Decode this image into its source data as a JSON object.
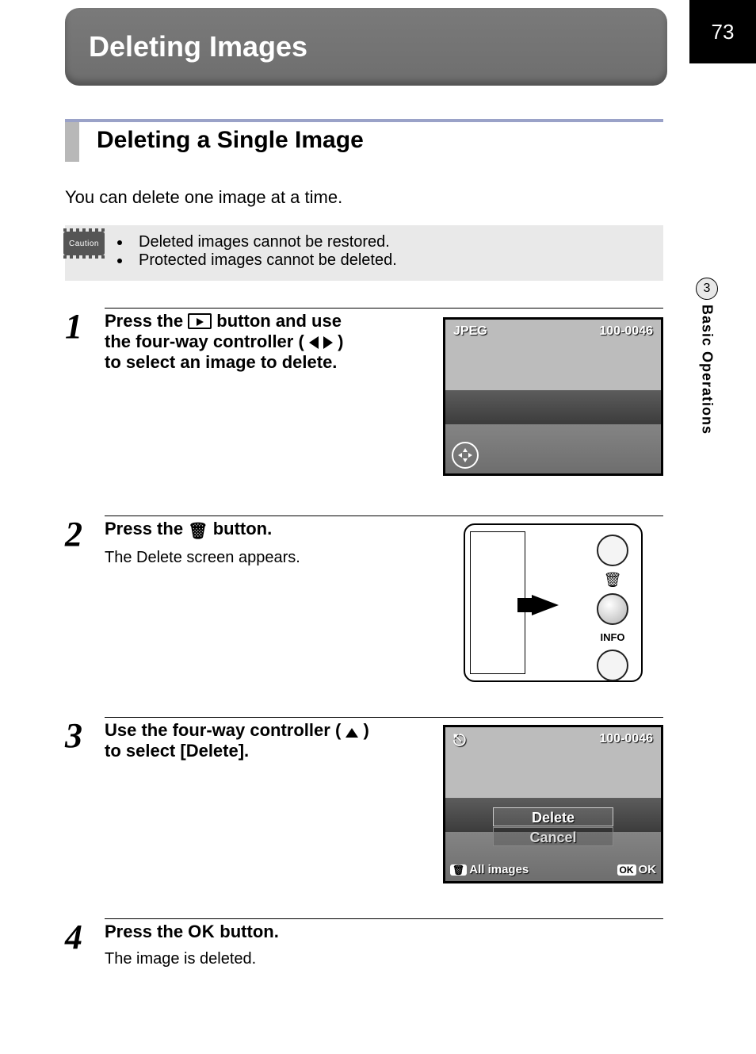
{
  "page_number": "73",
  "side_tab": {
    "chapter_num": "3",
    "chapter_title": "Basic Operations"
  },
  "banner_title": "Deleting Images",
  "section": {
    "title": "Deleting a Single Image"
  },
  "intro_text": "You can delete one image at a time.",
  "caution": {
    "badge": "Caution",
    "items": [
      "Deleted images cannot be restored.",
      "Protected images cannot be deleted."
    ]
  },
  "steps": {
    "s1": {
      "num": "1",
      "line_a": "Press the ",
      "line_b": " button and use",
      "line_c": "the four-way controller (",
      "line_d": ")",
      "line_e": "to select an image to delete."
    },
    "s2": {
      "num": "2",
      "line_a": "Press the ",
      "line_b": " button.",
      "sub": "The Delete screen appears."
    },
    "s3": {
      "num": "3",
      "line_a": "Use the four-way controller (",
      "line_b": ")",
      "line_c": "to select [Delete]."
    },
    "s4": {
      "num": "4",
      "line_a": "Press the ",
      "ok": "OK",
      "line_b": " button.",
      "sub": "The image is deleted."
    }
  },
  "lcd1": {
    "left": "JPEG",
    "right": "100-0046"
  },
  "camback": {
    "info": "INFO"
  },
  "lcd3": {
    "right": "100-0046",
    "menu": {
      "delete": "Delete",
      "cancel": "Cancel"
    },
    "bottom": {
      "all": "All images",
      "ok_badge": "OK",
      "ok": "OK"
    }
  }
}
